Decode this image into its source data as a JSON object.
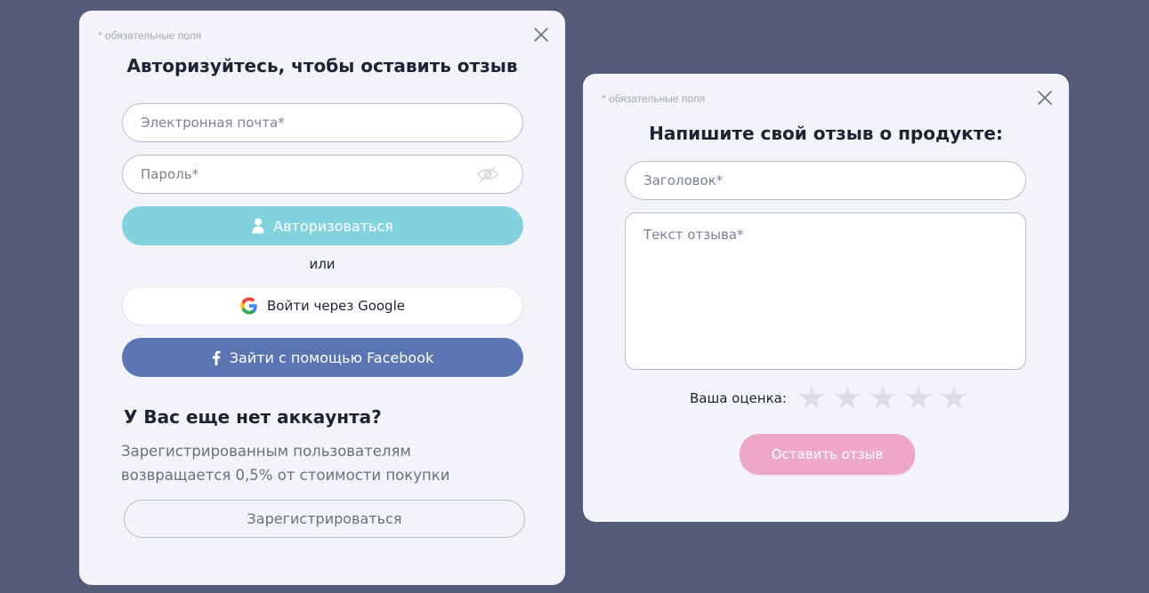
{
  "login": {
    "required_note": "* обязательные поля",
    "title": "Авторизуйтесь, чтобы оставить отзыв",
    "email_placeholder": "Электронная почта*",
    "password_placeholder": "Пароль*",
    "auth_button": "Авторизоваться",
    "or_text": "или",
    "google_button": "Войти через Google",
    "facebook_button": "Зайти с помощью Facebook",
    "no_account_title": "У Вас еще нет аккаунта?",
    "cashback_line1": "Зарегистрированным пользователям",
    "cashback_line2": "возвращается 0,5% от стоимости покупки",
    "register_button": "Зарегистрироваться"
  },
  "review": {
    "required_note": "* обязательные поля",
    "title": "Напишите свой отзыв о продукте:",
    "headline_placeholder": "Заголовок*",
    "text_placeholder": "Текст отзыва*",
    "rating_label": "Ваша оценка:",
    "rating_value": 0,
    "rating_max": 5,
    "submit_button": "Оставить отзыв"
  },
  "icons": {
    "close": "close-icon",
    "eye": "eye-off-icon",
    "user": "user-icon",
    "google": "google-logo-icon",
    "facebook": "facebook-icon",
    "star": "star-icon"
  },
  "colors": {
    "backdrop": "#545b78",
    "modal_bg": "#f3f4f9",
    "auth_button": "#82d3de",
    "facebook_button": "#5b75b3",
    "submit_button": "#eea8c6",
    "star_empty": "#dcdde8"
  }
}
